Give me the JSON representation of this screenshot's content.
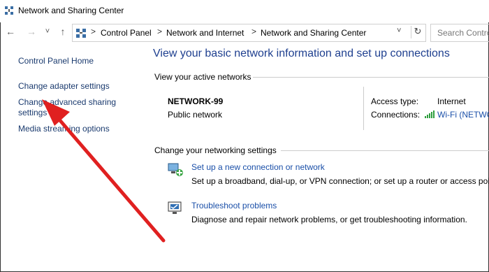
{
  "window": {
    "title": "Network and Sharing Center"
  },
  "nav": {
    "back": "←",
    "forward": "→",
    "recent": "˅",
    "up": "↑"
  },
  "address": {
    "crumbs": [
      "Control Panel",
      "Network and Internet",
      "Network and Sharing Center"
    ],
    "separator": ">",
    "dropdown": "˅",
    "refresh": "↻"
  },
  "search": {
    "placeholder": "Search Contro"
  },
  "sidebar": {
    "items": [
      {
        "label": "Control Panel Home"
      },
      {
        "label": "Change adapter settings"
      },
      {
        "label": "Change advanced sharing settings"
      },
      {
        "label": "Media streaming options"
      }
    ]
  },
  "main": {
    "heading": "View your basic network information and set up connections",
    "active_label": "View your active networks",
    "network": {
      "name": "NETWORK-99",
      "type": "Public network",
      "access_type_label": "Access type:",
      "access_type_value": "Internet",
      "connections_label": "Connections:",
      "connections_value": "Wi-Fi (NETWO"
    },
    "change_label": "Change your networking settings",
    "actions": [
      {
        "title": "Set up a new connection or network",
        "desc": "Set up a broadband, dial-up, or VPN connection; or set up a router or access poir"
      },
      {
        "title": "Troubleshoot problems",
        "desc": "Diagnose and repair network problems, or get troubleshooting information."
      }
    ]
  },
  "colors": {
    "link": "#1a4fa8",
    "heading": "#1e3f8f",
    "annotation_arrow": "#e02020"
  }
}
